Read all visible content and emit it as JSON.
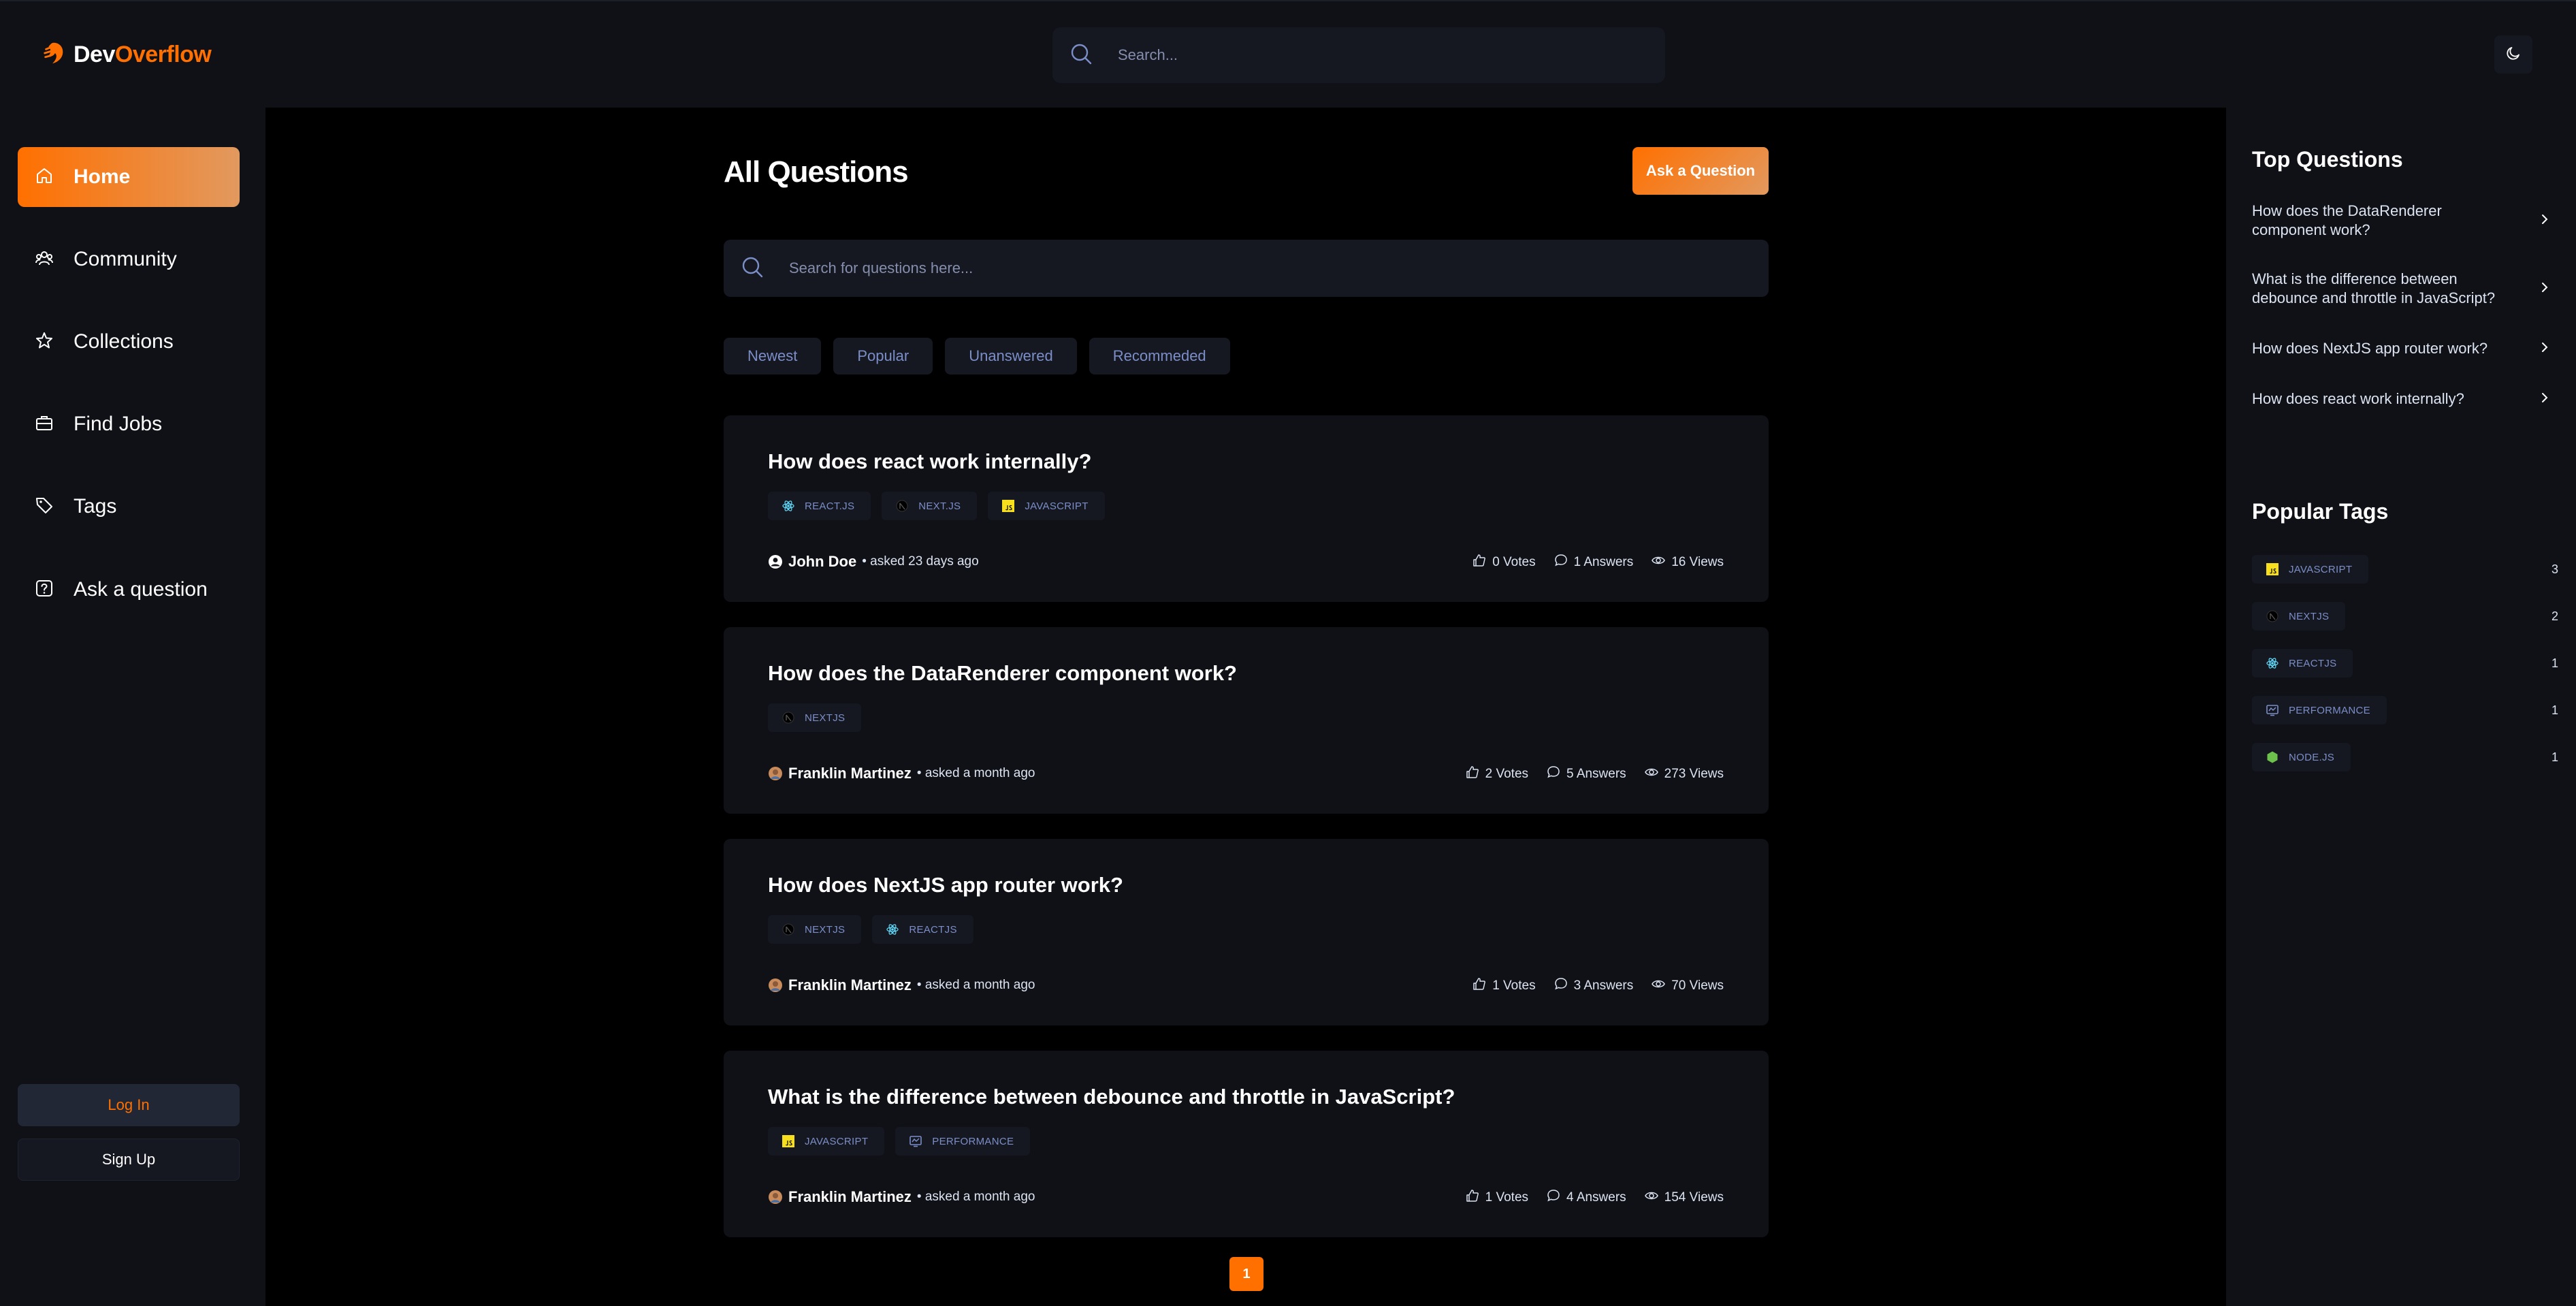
{
  "app": {
    "logo_part1": "Dev",
    "logo_part2": "Overflow",
    "brand_color": "#ff7000"
  },
  "header": {
    "search_placeholder": "Search...",
    "theme_icon": "moon-icon"
  },
  "sidebar": {
    "items": [
      {
        "label": "Home",
        "icon": "home-icon",
        "active": true
      },
      {
        "label": "Community",
        "icon": "users-icon",
        "active": false
      },
      {
        "label": "Collections",
        "icon": "star-icon",
        "active": false
      },
      {
        "label": "Find Jobs",
        "icon": "briefcase-icon",
        "active": false
      },
      {
        "label": "Tags",
        "icon": "tag-icon",
        "active": false
      },
      {
        "label": "Ask a question",
        "icon": "question-icon",
        "active": false
      }
    ],
    "login_label": "Log In",
    "signup_label": "Sign Up"
  },
  "main": {
    "title": "All Questions",
    "ask_button": "Ask a Question",
    "search_placeholder": "Search for questions here...",
    "filters": [
      "Newest",
      "Popular",
      "Unanswered",
      "Recommeded"
    ],
    "questions": [
      {
        "title": "How does react work internally?",
        "tags": [
          "REACT.JS",
          "NEXT.JS",
          "JAVASCRIPT"
        ],
        "author": "John Doe",
        "asked": "• asked 23 days ago",
        "votes": "0 Votes",
        "answers": "1 Answers",
        "views": "16 Views"
      },
      {
        "title": "How does the DataRenderer component work?",
        "tags": [
          "NEXTJS"
        ],
        "author": "Franklin Martinez",
        "asked": "• asked a month ago",
        "votes": "2 Votes",
        "answers": "5 Answers",
        "views": "273 Views"
      },
      {
        "title": "How does NextJS app router work?",
        "tags": [
          "NEXTJS",
          "REACTJS"
        ],
        "author": "Franklin Martinez",
        "asked": "• asked a month ago",
        "votes": "1 Votes",
        "answers": "3 Answers",
        "views": "70 Views"
      },
      {
        "title": "What is the difference between debounce and throttle in JavaScript?",
        "tags": [
          "JAVASCRIPT",
          "PERFORMANCE"
        ],
        "author": "Franklin Martinez",
        "asked": "• asked a month ago",
        "votes": "1 Votes",
        "answers": "4 Answers",
        "views": "154 Views"
      }
    ],
    "current_page": "1"
  },
  "right_sidebar": {
    "top_questions_title": "Top Questions",
    "top_questions": [
      "How does the DataRenderer component work?",
      "What is the difference between debounce and throttle in JavaScript?",
      "How does NextJS app router work?",
      "How does react work internally?"
    ],
    "popular_tags_title": "Popular Tags",
    "popular_tags": [
      {
        "name": "JAVASCRIPT",
        "count": "3"
      },
      {
        "name": "NEXTJS",
        "count": "2"
      },
      {
        "name": "REACTJS",
        "count": "1"
      },
      {
        "name": "PERFORMANCE",
        "count": "1"
      },
      {
        "name": "NODE.JS",
        "count": "1"
      }
    ]
  }
}
